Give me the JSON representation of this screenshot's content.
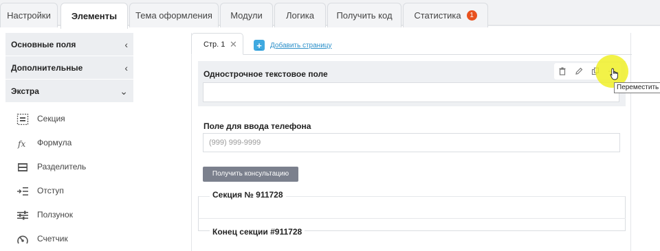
{
  "tabs": [
    {
      "label": "Настройки"
    },
    {
      "label": "Элементы"
    },
    {
      "label": "Тема оформления"
    },
    {
      "label": "Модули"
    },
    {
      "label": "Логика"
    },
    {
      "label": "Получить код"
    },
    {
      "label": "Статистика",
      "badge": "1"
    }
  ],
  "sidebar": {
    "groups": [
      {
        "label": "Основные поля",
        "chevron": "‹"
      },
      {
        "label": "Дополнительные",
        "chevron": "‹"
      },
      {
        "label": "Экстра",
        "chevron": "⌄"
      }
    ],
    "items": [
      {
        "label": "Секция",
        "icon": "section-icon"
      },
      {
        "label": "Формула",
        "icon": "formula-icon"
      },
      {
        "label": "Разделитель",
        "icon": "divider-icon"
      },
      {
        "label": "Отступ",
        "icon": "indent-icon"
      },
      {
        "label": "Ползунок",
        "icon": "slider-icon"
      },
      {
        "label": "Счетчик",
        "icon": "counter-icon"
      }
    ]
  },
  "page_tabs": {
    "current": "Стр. 1",
    "add_label": "Добавить страницу"
  },
  "form": {
    "field1_label": "Однострочное текстовое поле",
    "tooltip": "Переместить",
    "phone_label": "Поле для ввода телефона",
    "phone_placeholder": "(999) 999-9999",
    "button_label": "Получить консультацию",
    "section_title": "Секция № 911728",
    "section_end": "Конец секции #911728"
  },
  "colors": {
    "badge": "#e8521f",
    "accent": "#3fa9e0",
    "button": "#7b808d",
    "cursor_highlight": "#f0f028"
  }
}
